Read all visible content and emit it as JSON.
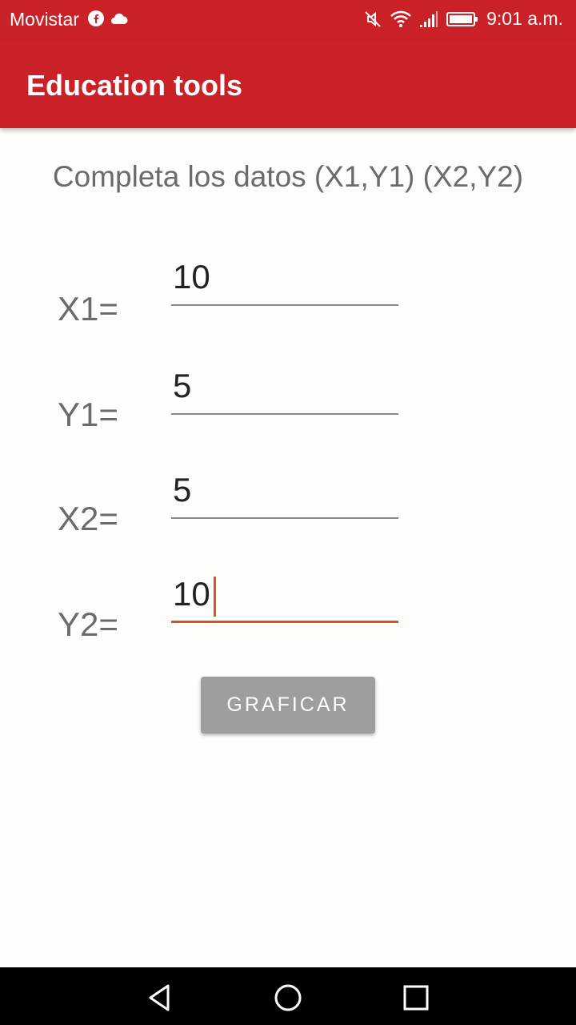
{
  "status_bar": {
    "carrier": "Movistar",
    "time": "9:01 a.m.",
    "icons": [
      "facebook-icon",
      "cloud-icon",
      "mute-icon",
      "wifi-icon",
      "signal-icon",
      "battery-icon"
    ]
  },
  "app_bar": {
    "title": "Education tools",
    "color": "#c92127"
  },
  "form": {
    "instruction": "Completa los datos (X1,Y1) (X2,Y2)",
    "fields": [
      {
        "label": "X1=",
        "value": "10"
      },
      {
        "label": "Y1=",
        "value": "5"
      },
      {
        "label": "X2=",
        "value": "5"
      },
      {
        "label": "Y2=",
        "value": "10"
      }
    ],
    "accent_color": "#d9531e"
  },
  "button": {
    "label": "GRAFICAR"
  },
  "nav_bar": {
    "icons": [
      "back-icon",
      "home-icon",
      "recents-icon"
    ]
  }
}
